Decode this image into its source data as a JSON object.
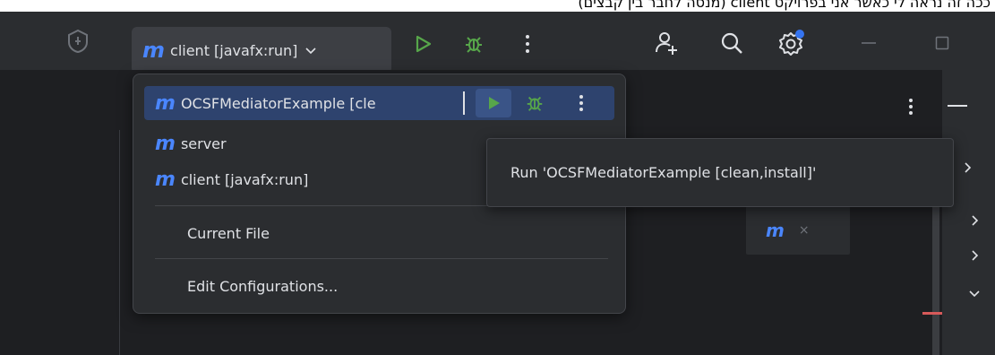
{
  "header_note": "ככה זה נראה לי כאשר אני בפרויקט client (מנסה לחבר בין קבצים)",
  "toolbar": {
    "run_config": {
      "icon": "maven-icon",
      "glyph": "m",
      "label": "client [javafx:run]"
    },
    "icons": [
      "project-widget-icon",
      "chevron-down-icon",
      "run-icon",
      "debug-icon",
      "more-vertical-icon",
      "add-user-icon",
      "search-icon",
      "settings-icon",
      "minimize-icon",
      "maximize-icon"
    ]
  },
  "popup": {
    "items": [
      {
        "glyph": "m",
        "label": "OCSFMediatorExample [cle",
        "selected": true
      },
      {
        "glyph": "m",
        "label": "server"
      },
      {
        "glyph": "m",
        "label": "client [javafx:run]"
      }
    ],
    "current_file": "Current File",
    "edit_configurations": "Edit Configurations..."
  },
  "tooltip": {
    "text": "Run 'OCSFMediatorExample [clean,install]'"
  },
  "editor_tab": {
    "glyph": "m",
    "close": "×"
  },
  "colors": {
    "accent_blue": "#4a86ff",
    "run_green": "#57a64a",
    "selection": "#2e436e",
    "panel_bg": "#2b2d30",
    "editor_bg": "#1e1f22",
    "error_red": "#d75a5a",
    "badge_blue": "#3574f0"
  }
}
